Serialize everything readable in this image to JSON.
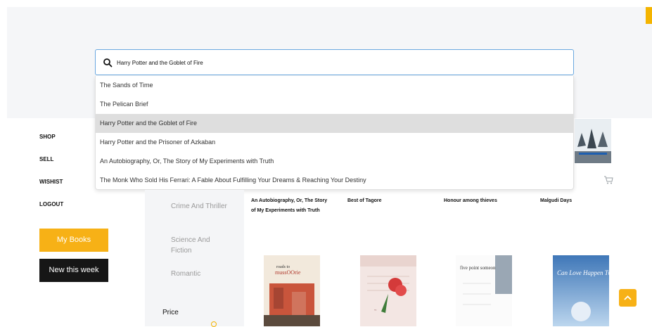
{
  "search": {
    "value": "Harry Potter and the Goblet of Fire",
    "suggestions": [
      "The Sands of Time",
      "The Pelican Brief",
      "Harry Potter and the Goblet of Fire",
      "Harry Potter and the Prisoner of Azkaban",
      "An Autobiography, Or, The Story of My Experiments with Truth",
      "The Monk Who Sold His Ferrari: A Fable About Fulfilling Your Dreams & Reaching Your Destiny"
    ],
    "highlighted_index": 2
  },
  "nav": {
    "shop": "SHOP",
    "sell": "SELL",
    "wishist": "WISHIST",
    "logout": "LOGOUT"
  },
  "buttons": {
    "my_books": "My Books",
    "new_this_week": "New this week"
  },
  "categories": [
    "Crime And Thriller",
    "Science And Fiction",
    "Romantic"
  ],
  "filters": {
    "price_label": "Price"
  },
  "books": [
    {
      "title": "An Autobiography, Or, The Story of My Experiments with Truth"
    },
    {
      "title": "Best of Tagore"
    },
    {
      "title": "Honour among thieves"
    },
    {
      "title": "Malgudi Days"
    }
  ],
  "covers": [
    {
      "text1": "roads to",
      "text2": "mussOOrie"
    },
    {
      "text1": "",
      "text2": ""
    },
    {
      "text1": "five point someone",
      "text2": ""
    },
    {
      "text1": "Can Love Happen Twice",
      "text2": ""
    }
  ],
  "colors": {
    "accent": "#f7b116",
    "dark": "#161616",
    "highlight": "#dedede"
  },
  "icons": {
    "search": "search-icon",
    "cart": "cart-icon",
    "scroll_top": "chevron-up-icon"
  }
}
